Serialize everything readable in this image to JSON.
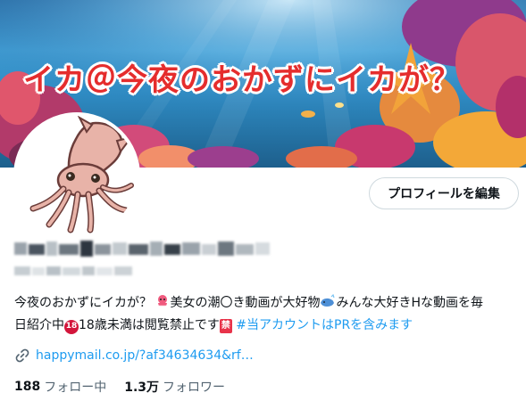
{
  "banner": {
    "title": "イカ＠今夜のおかずにイカが？"
  },
  "profile": {
    "edit_button": "プロフィールを編集",
    "bio_line1_text": "今夜のおかずにイカが？",
    "bio_line1_mid": "美女の潮〇き動画が大好物",
    "bio_line1_end": "みんな大好きHな動画を毎",
    "bio_line2_start": "日紹介中",
    "bio_badge_18": "18",
    "bio_line2_mid": "18歳未満は閲覧禁止です",
    "bio_badge_kin": "禁",
    "bio_pr": "#当アカウントはPRを含みます",
    "link": "happymail.co.jp/?af34634634&rf…"
  },
  "stats": {
    "following_count": "188",
    "following_label": "フォロー中",
    "followers_count": "1.3万",
    "followers_label": "フォロワー"
  },
  "colors": {
    "accent": "#1d9bf0",
    "banner_text": "#e52d2d"
  },
  "icons": [
    "link-icon",
    "octopus-emoji",
    "whale-emoji",
    "avatar-squid"
  ]
}
